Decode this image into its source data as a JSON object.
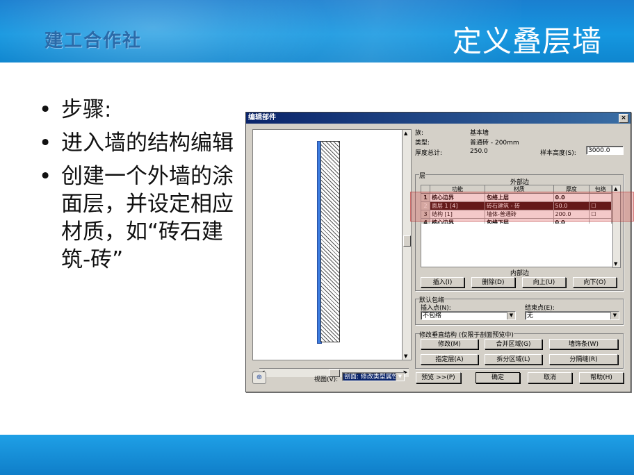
{
  "slide": {
    "logo_text": "建工合作社",
    "title": "定义叠层墙",
    "bullets": [
      "步骤:",
      "进入墙的结构编辑",
      "创建一个外墙的涂面层，并设定相应材质，如“砖石建筑-砖”"
    ]
  },
  "dialog": {
    "title": "编辑部件",
    "close_glyph": "×",
    "info": {
      "family_label": "族:",
      "family_value": "基本墙",
      "type_label": "类型:",
      "type_value": "普通砖 - 200mm",
      "thickness_label": "厚度总计:",
      "thickness_value": "250.0",
      "sample_height_label": "样本高度(S):",
      "sample_height_value": "3000.0"
    },
    "layers": {
      "group_label": "层",
      "exterior_label": "外部边",
      "interior_label": "内部边",
      "columns": [
        "功能",
        "材质",
        "厚度",
        "包络"
      ],
      "rows": [
        {
          "num": "1",
          "function": "核心边界",
          "material": "包络上层",
          "thickness": "0.0",
          "wrap": ""
        },
        {
          "num": "2",
          "function": "面层 1 [4]",
          "material": "砖石建筑 - 砖",
          "thickness": "50.0",
          "wrap": "☐"
        },
        {
          "num": "3",
          "function": "结构 [1]",
          "material": "墙体-普通砖",
          "thickness": "200.0",
          "wrap": "☐"
        },
        {
          "num": "4",
          "function": "核心边界",
          "material": "包络下层",
          "thickness": "0.0",
          "wrap": ""
        }
      ],
      "buttons": [
        "插入(I)",
        "删除(D)",
        "向上(U)",
        "向下(O)"
      ]
    },
    "default_wrap": {
      "group_label": "默认包络",
      "insert_label": "插入点(N):",
      "insert_value": "不包络",
      "end_label": "结束点(E):",
      "end_value": "无"
    },
    "vertical": {
      "group_label": "修改垂直结构 (仅限于剖面预览中)",
      "buttons": [
        "修改(M)",
        "合并区域(G)",
        "墙饰条(W)",
        "指定层(A)",
        "拆分区域(L)",
        "分隔缝(R)"
      ]
    },
    "bottom": {
      "view_label": "视图(V):",
      "view_value": "剖面: 修改类型属性",
      "preview_button": "预览 >>(P)",
      "ok_button": "确定",
      "cancel_button": "取消",
      "help_button": "帮助(H)"
    }
  }
}
